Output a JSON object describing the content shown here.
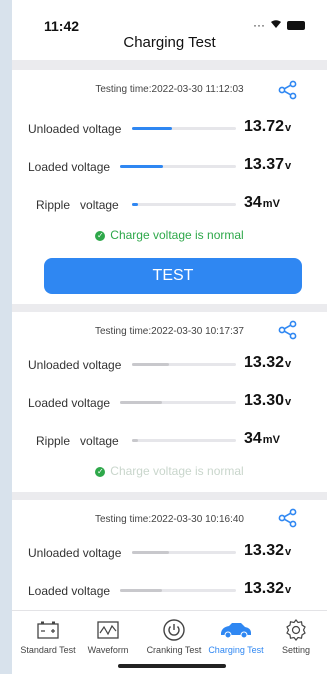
{
  "status_bar": {
    "time": "11:42"
  },
  "nav": {
    "title": "Charging Test"
  },
  "cards": [
    {
      "testing_time": "Testing time:2022-03-30 11:12:03",
      "rows": [
        {
          "label": "Unloaded voltage",
          "value": "13.72",
          "unit": "v",
          "level": 0.38
        },
        {
          "label": "Loaded voltage",
          "value": "13.37",
          "unit": "v",
          "level": 0.37
        },
        {
          "label": "Ripple   voltage",
          "value": "34",
          "unit": "mV",
          "level": 0.08
        }
      ],
      "status": "Charge voltage is normal",
      "button": "TEST"
    },
    {
      "testing_time": "Testing time:2022-03-30 10:17:37",
      "rows": [
        {
          "label": "Unloaded voltage",
          "value": "13.32",
          "unit": "v",
          "level": 0.36
        },
        {
          "label": "Loaded voltage",
          "value": "13.30",
          "unit": "v",
          "level": 0.36
        },
        {
          "label": "Ripple   voltage",
          "value": "34",
          "unit": "mV",
          "level": 0.08
        }
      ],
      "status": "Charge voltage is normal"
    },
    {
      "testing_time": "Testing time:2022-03-30 10:16:40",
      "rows": [
        {
          "label": "Unloaded voltage",
          "value": "13.32",
          "unit": "v",
          "level": 0.36
        },
        {
          "label": "Loaded voltage",
          "value": "13.32",
          "unit": "v",
          "level": 0.36
        }
      ]
    }
  ],
  "tabs": [
    {
      "label": "Standard Test",
      "icon": "battery-icon"
    },
    {
      "label": "Waveform",
      "icon": "waveform-icon"
    },
    {
      "label": "Cranking Test",
      "icon": "power-icon"
    },
    {
      "label": "Charging Test",
      "icon": "car-icon",
      "active": true
    },
    {
      "label": "Setting",
      "icon": "gear-icon"
    }
  ],
  "colors": {
    "accent": "#2f87f2",
    "active_fill": "#2f87f2",
    "inactive_fill": "#c8c8cc",
    "ok_green": "#2ea84a",
    "ok_faded": "#cfe6d4"
  }
}
